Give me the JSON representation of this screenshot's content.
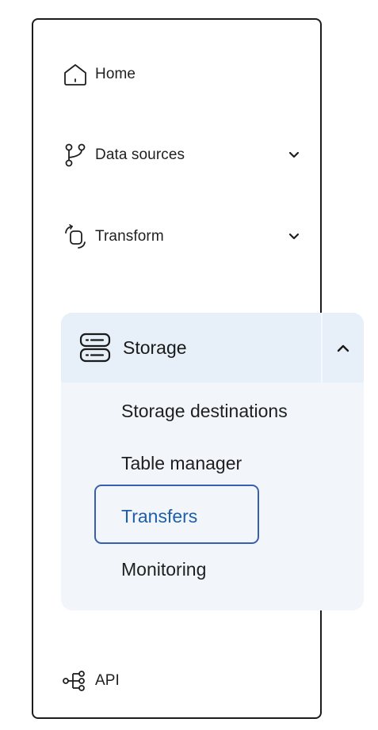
{
  "nav": {
    "home": {
      "label": "Home",
      "icon": "home-icon"
    },
    "data_sources": {
      "label": "Data sources",
      "icon": "branch-icon",
      "chevron": "chevron-down-icon"
    },
    "transform": {
      "label": "Transform",
      "icon": "transform-icon",
      "chevron": "chevron-down-icon"
    },
    "api": {
      "label": "API",
      "icon": "api-tree-icon"
    }
  },
  "storage": {
    "label": "Storage",
    "icon": "storage-icon",
    "toggle_icon": "chevron-up-icon",
    "expanded": true,
    "items": [
      {
        "label": "Storage destinations",
        "active": false
      },
      {
        "label": "Table manager",
        "active": false
      },
      {
        "label": "Transfers",
        "active": true
      },
      {
        "label": "Monitoring",
        "active": false
      }
    ]
  },
  "colors": {
    "active_text": "#1e5fa8",
    "active_outline": "#3a5fb0",
    "panel_bg": "#f2f6fb",
    "panel_header_bg": "#e7eff8",
    "sidebar_border": "#1c1c1c"
  }
}
